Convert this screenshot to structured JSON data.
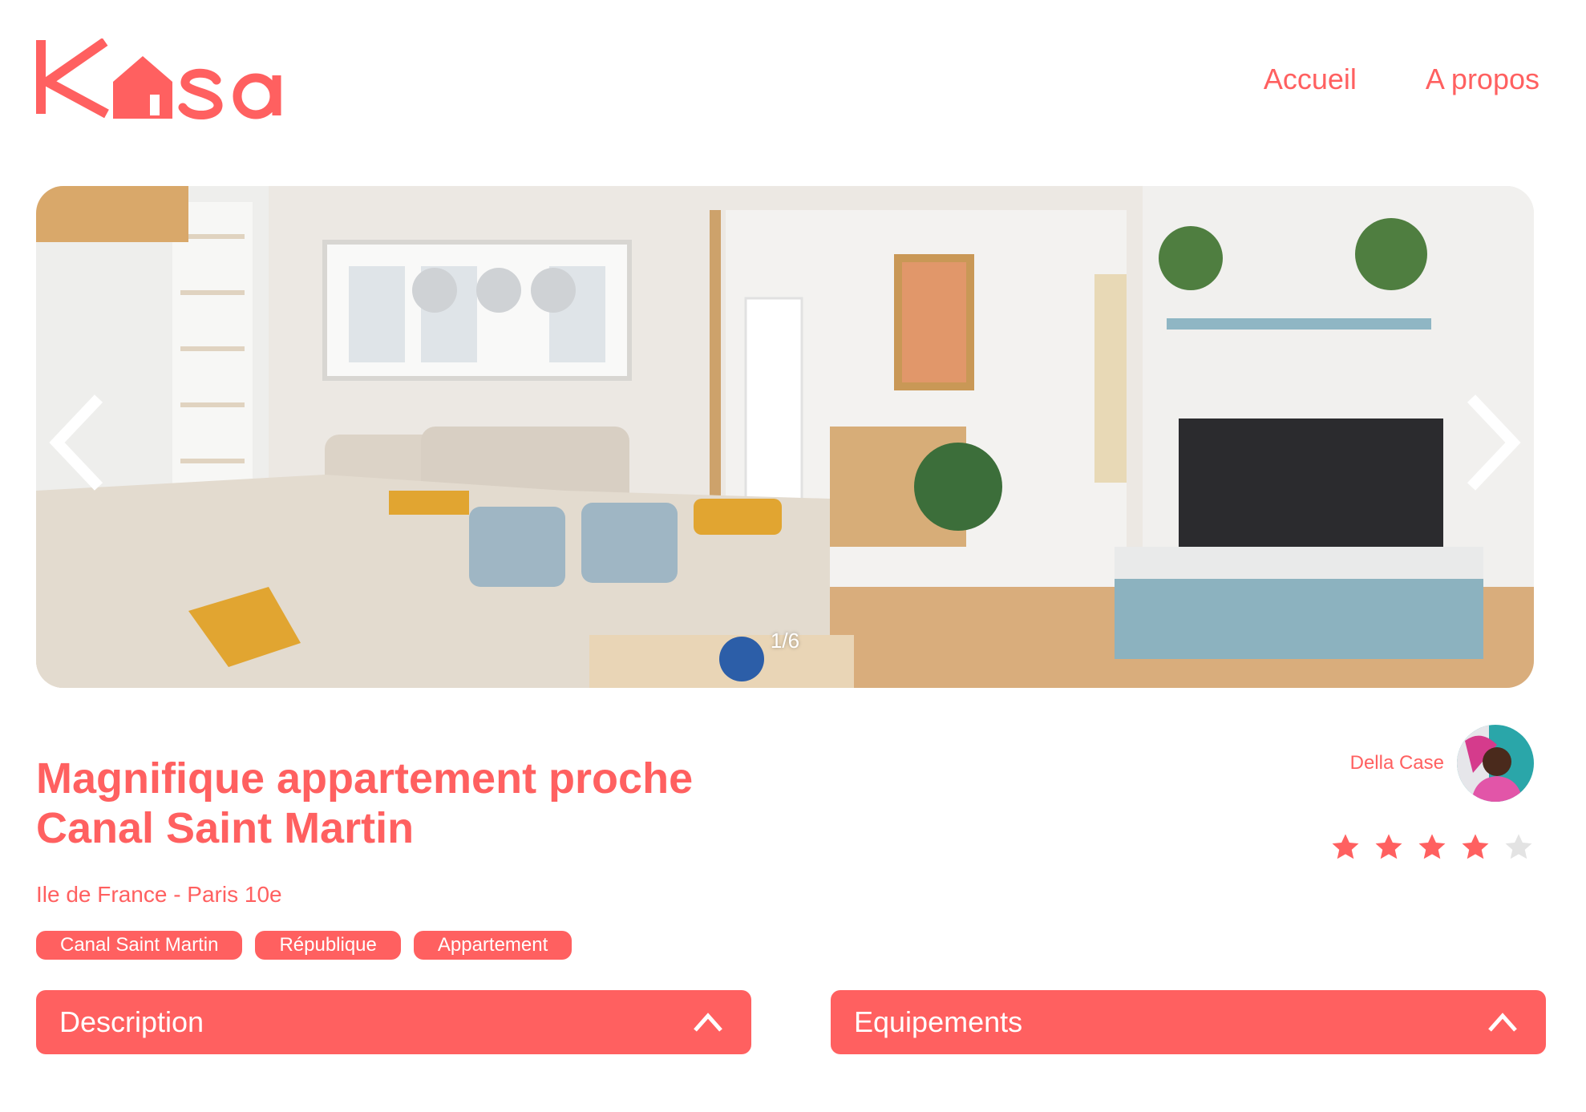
{
  "brand": {
    "logo_text": "Kasa",
    "color": "#FF6060"
  },
  "nav": {
    "home": "Accueil",
    "about": "A propos"
  },
  "gallery": {
    "counter": "1/6",
    "photo": "living-room-photo"
  },
  "listing": {
    "title": "Magnifique appartement proche Canal Saint Martin",
    "location": "Ile de France - Paris 10e",
    "tags": [
      "Canal Saint Martin",
      "République",
      "Appartement"
    ],
    "host_name": "Della Case",
    "rating": 4,
    "rating_max": 5
  },
  "collapses": {
    "description": "Description",
    "equipments": "Equipements"
  },
  "colors": {
    "accent": "#FF6060",
    "star_empty": "#E3E3E3",
    "white": "#FFFFFF"
  }
}
